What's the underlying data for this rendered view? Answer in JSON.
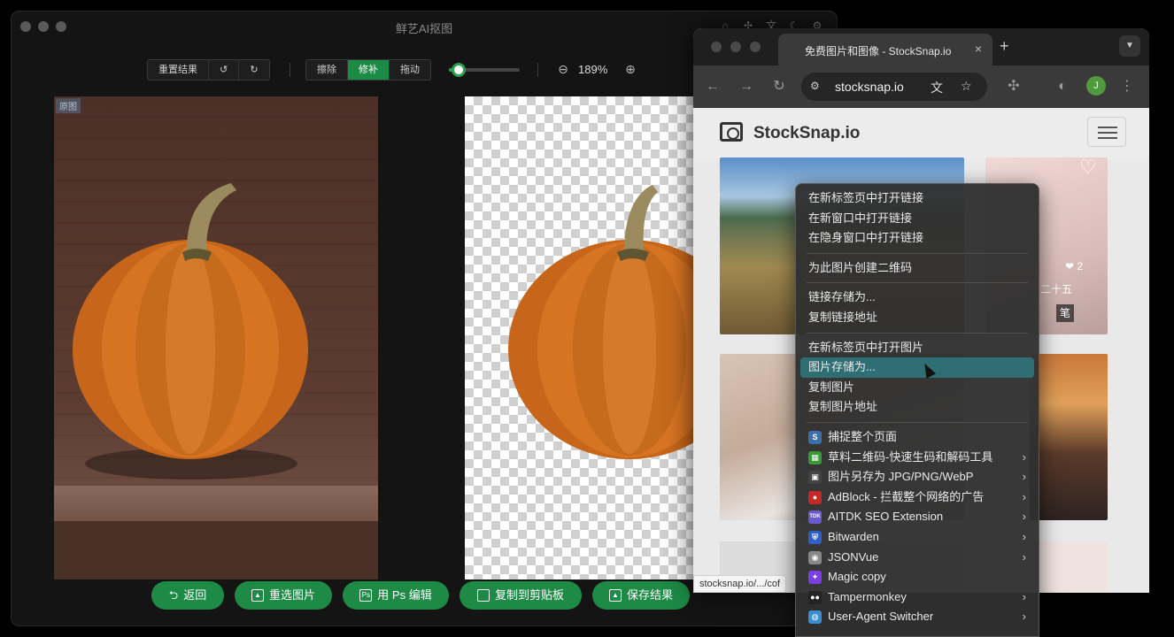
{
  "app": {
    "title": "鲜艺AI抠图",
    "toolbar": {
      "reset_label": "重置结果",
      "undo_icon": "undo-icon",
      "redo_icon": "redo-icon",
      "erase_label": "擦除",
      "repair_label": "修补",
      "drag_label": "拖动",
      "brush_size": 0.14,
      "zoom_level": "189%"
    },
    "original_tag": "原图",
    "bottom_buttons": {
      "back": "返回",
      "reselect": "重选图片",
      "ps_edit": "用 Ps 编辑",
      "copy_clipboard": "复制到剪贴板",
      "save": "保存结果"
    },
    "colors": {
      "accent": "#1d8a46"
    }
  },
  "browser": {
    "tab_title": "免费图片和图像 - StockSnap.io",
    "url": "stocksnap.io",
    "avatar_letter": "J",
    "site_name": "StockSnap.io",
    "photo_overlay": {
      "likes": "2",
      "caption": "二十五",
      "tag": "笔"
    },
    "status_url": "stocksnap.io/.../cof"
  },
  "context_menu": {
    "items": [
      {
        "label": "在新标签页中打开链接"
      },
      {
        "label": "在新窗口中打开链接"
      },
      {
        "label": "在隐身窗口中打开链接"
      },
      {
        "label": "为此图片创建二维码"
      },
      {
        "label": "链接存储为..."
      },
      {
        "label": "复制链接地址"
      },
      {
        "label": "在新标签页中打开图片"
      },
      {
        "label": "图片存储为..."
      },
      {
        "label": "复制图片"
      },
      {
        "label": "复制图片地址"
      }
    ],
    "extensions": [
      {
        "label": "捕捉整个页面",
        "icon": "S",
        "color": "#3b6fb0"
      },
      {
        "label": "草料二维码-快速生码和解码工具",
        "icon": "▦",
        "color": "#3a9a3a"
      },
      {
        "label": "图片另存为 JPG/PNG/WebP",
        "icon": "▣",
        "color": "#444"
      },
      {
        "label": "AdBlock - 拦截整个网络的广告",
        "icon": "●",
        "color": "#c62828"
      },
      {
        "label": "AITDK SEO Extension",
        "icon": "TDK",
        "color": "#6a5acd"
      },
      {
        "label": "Bitwarden",
        "icon": "⛨",
        "color": "#2f5fc8"
      },
      {
        "label": "JSONVue",
        "icon": "◉",
        "color": "#888"
      },
      {
        "label": "Magic copy",
        "icon": "✦",
        "color": "#7b3fe4"
      },
      {
        "label": "Tampermonkey",
        "icon": "●●",
        "color": "#222"
      },
      {
        "label": "User-Agent Switcher",
        "icon": "◍",
        "color": "#3b8ed0"
      }
    ]
  }
}
